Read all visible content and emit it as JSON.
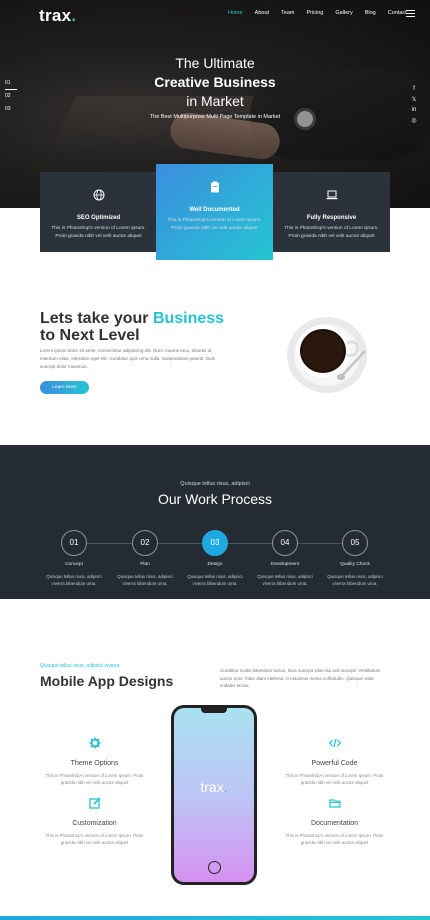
{
  "brand": {
    "name": "trax",
    "dot": "."
  },
  "nav": {
    "items": [
      "Home",
      "About",
      "Team",
      "Pricing",
      "Gallery",
      "Blog",
      "Contact"
    ]
  },
  "hero": {
    "line1": "The Ultimate",
    "line2": "Creative Business",
    "line3": "in Market",
    "subtitle": "The Best Multipurpose Multi Page Template in Market",
    "slides": [
      "01",
      "02",
      "03"
    ],
    "social": [
      "f",
      "𝕏",
      "in",
      "◎"
    ]
  },
  "features": [
    {
      "title": "SEO Optimized",
      "text1": "This is Photoshop's version of Lorem Ipsum.",
      "text2": "Proin gravida nibh vel velit auctor aliquet"
    },
    {
      "title": "Well Documented",
      "text1": "This is Photoshop's version of Lorem Ipsum.",
      "text2": "Proin gravida nibh vel velit auctor aliquet"
    },
    {
      "title": "Fully Responsive",
      "text1": "This is Photoshop's version of Lorem Ipsum.",
      "text2": "Proin gravida nibh vel velit auctor aliquet"
    }
  ],
  "business": {
    "heading1": "Lets take your ",
    "heading_accent": "Business",
    "heading2": "to Next Level",
    "paragraph": "Lorem ipsum dolor sit amet, consectetur adipiscing elit. Nunc mauris arcu, lobortis id interdum vitae, interdum eget elit. Curabitur quis urna nulla. Suspendisse potenti. Duis suscipit dolor maximus.",
    "button": "Learn More"
  },
  "process": {
    "kicker": "Quisque tellus risus, adipisci",
    "title": "Our Work Process",
    "steps": [
      {
        "num": "01",
        "label": "Concept",
        "desc1": "Quisque tellus risus, adipisci",
        "desc2": "viverra bibendum urna."
      },
      {
        "num": "02",
        "label": "Plan",
        "desc1": "Quisque tellus risus, adipisci",
        "desc2": "viverra bibendum urna."
      },
      {
        "num": "03",
        "label": "Design",
        "desc1": "Quisque tellus risus, adipisci",
        "desc2": "viverra bibendum urna."
      },
      {
        "num": "04",
        "label": "Development",
        "desc1": "Quisque tellus risus, adipisci",
        "desc2": "viverra bibendum urna."
      },
      {
        "num": "05",
        "label": "Quality Check",
        "desc1": "Quisque tellus risus, adipisci",
        "desc2": "viverra bibendum urna."
      }
    ]
  },
  "apps": {
    "kicker": "Quisque tellus risus, adipisci viverra",
    "title": "Mobile App Designs",
    "paragraph": "Curabitur mollis bibendum luctus. Duis suscipit vitae dui sed suscipit. Vestibulum auctor nunc Vitae diam eleifend, in maximus metus sollicitudin. Quisque vitae sodales lectus.",
    "phone_logo": "trax",
    "features": [
      {
        "title": "Theme Options",
        "text1": "This is Photoshop's version of Lorem Ipsum. Proin",
        "text2": "gravida nibh vel velit auctor aliquet"
      },
      {
        "title": "Powerful Code",
        "text1": "This is Photoshop's version of Lorem Ipsum. Proin",
        "text2": "gravida nibh vel velit auctor aliquet"
      },
      {
        "title": "Customization",
        "text1": "This is Photoshop's version of Lorem Ipsum. Proin",
        "text2": "gravida nibh vel velit auctor aliquet"
      },
      {
        "title": "Documentation",
        "text1": "This is Photoshop's version of Lorem Ipsum. Proin",
        "text2": "gravida nibh vel velit auctor aliquet"
      }
    ]
  },
  "colors": {
    "accent": "#25c4d2",
    "blue": "#3b8edf",
    "dark": "#252b33",
    "card": "#2b323b"
  },
  "active_step": "03",
  "active_nav": "Home"
}
